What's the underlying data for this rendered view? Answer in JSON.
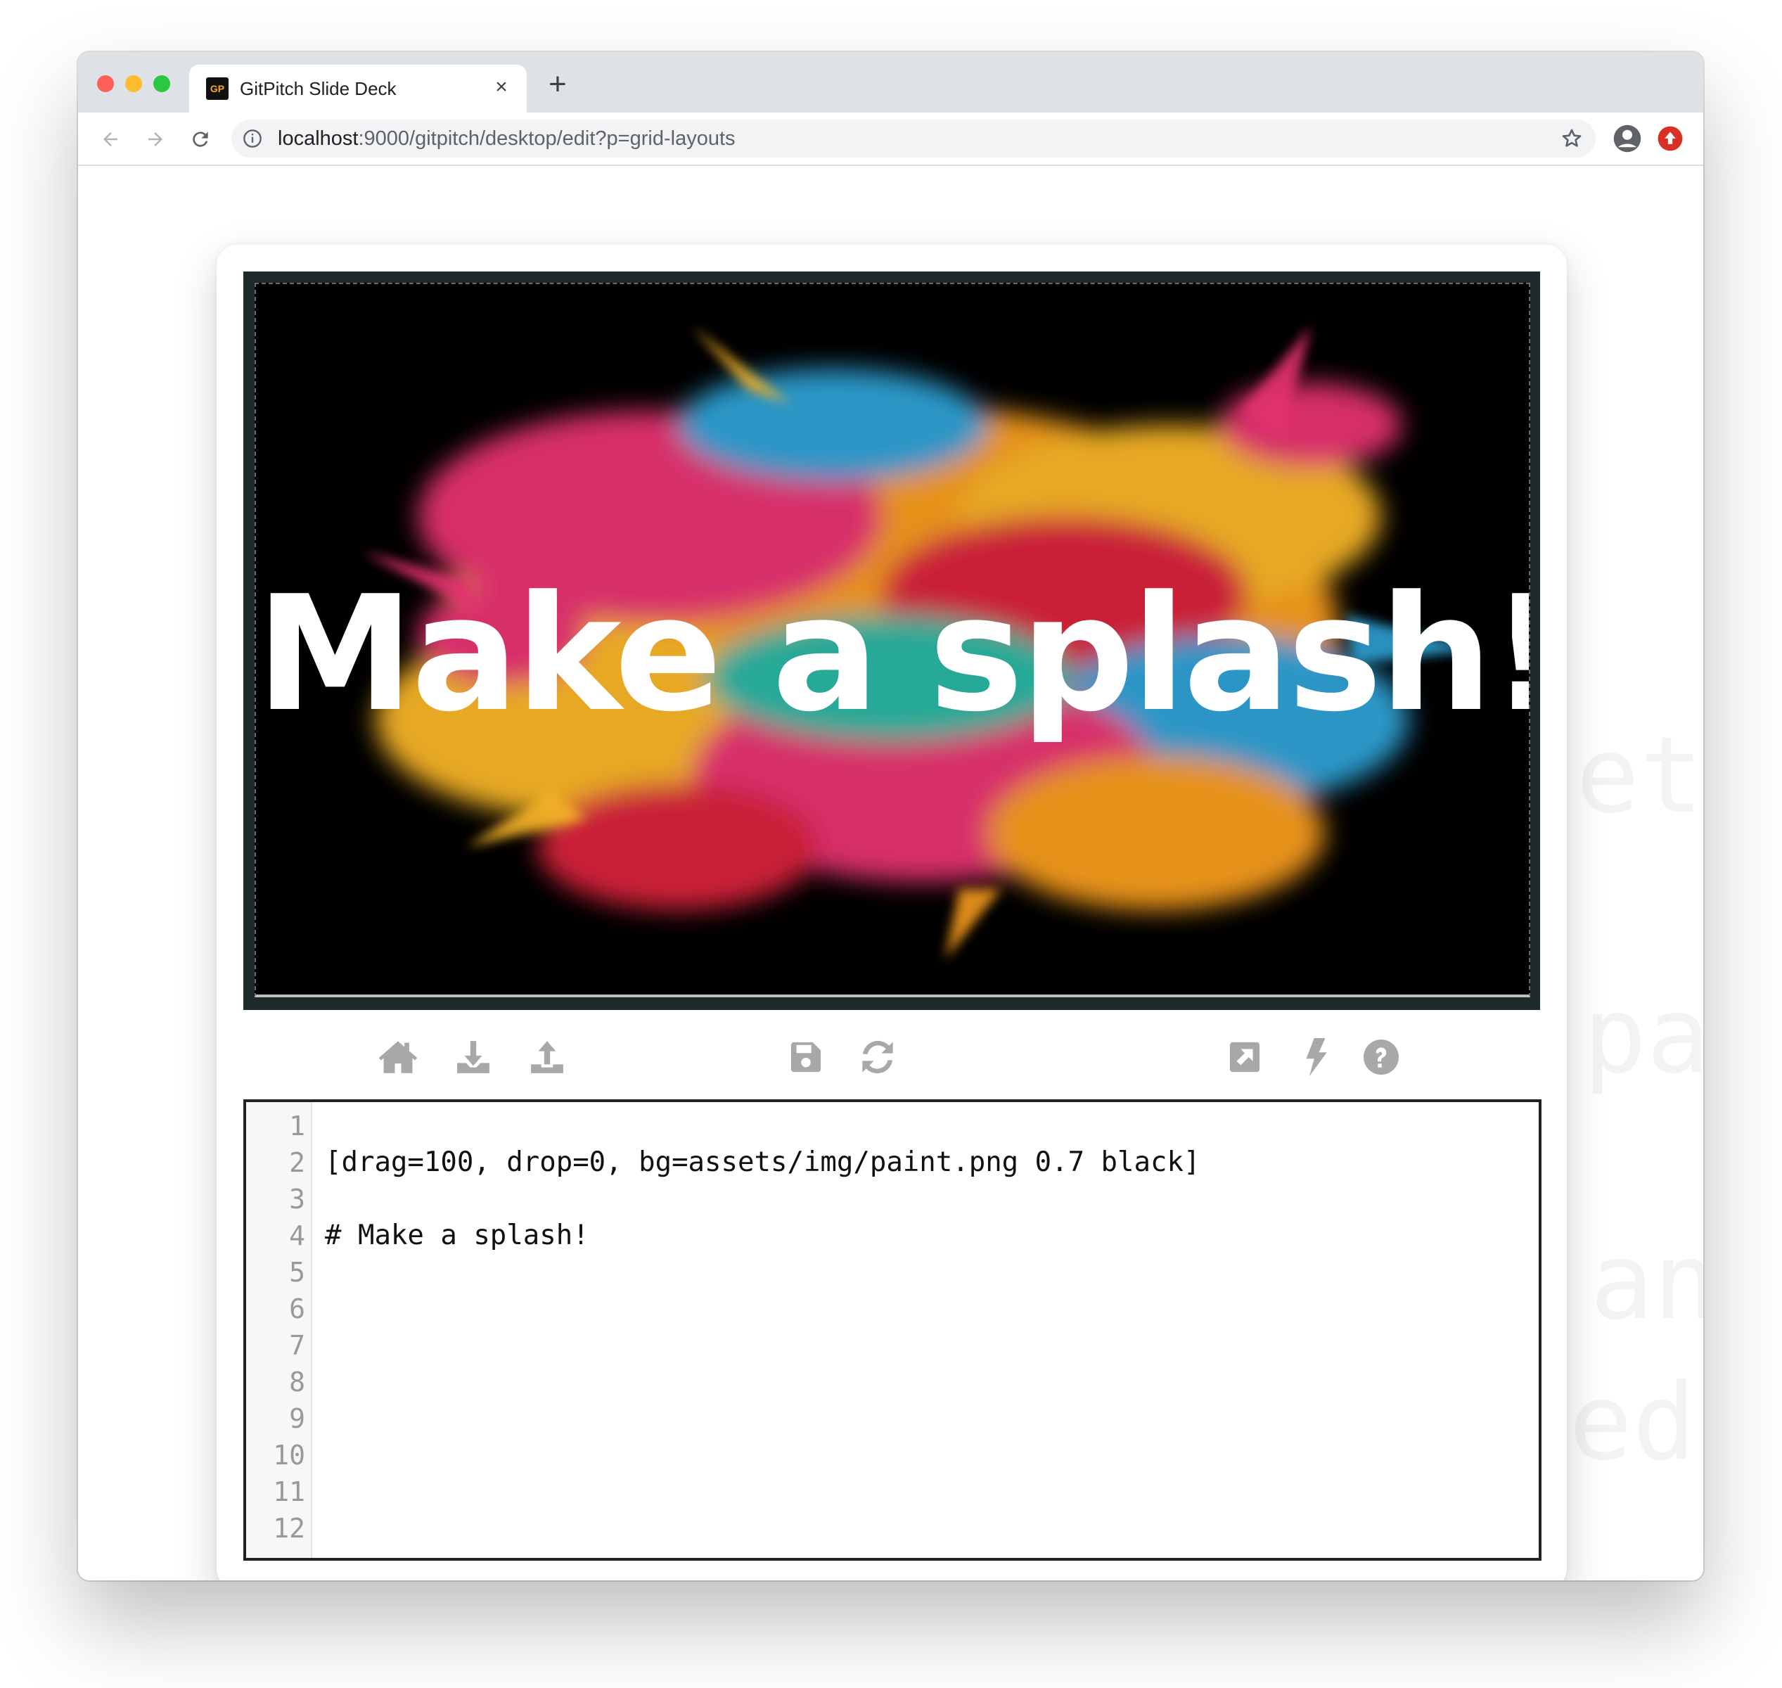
{
  "browser": {
    "tab": {
      "favicon_text": "GP",
      "title": "GitPitch Slide Deck"
    },
    "close_glyph": "×",
    "new_tab_glyph": "+",
    "url_host": "localhost",
    "url_path": ":9000/gitpitch/desktop/edit?p=grid-layouts"
  },
  "slide": {
    "heading": "Make a splash!",
    "background": "paint splash on black",
    "colors": {
      "pink": "#e3306f",
      "yellow": "#f4b228",
      "orange": "#f39a1e",
      "red": "#d4243b",
      "blue": "#2f9fd1",
      "teal": "#2bb3a0"
    }
  },
  "toolbar_icons": [
    "home-icon",
    "download-icon",
    "upload-icon",
    "save-icon",
    "refresh-icon",
    "external-link-icon",
    "lightning-icon",
    "help-icon"
  ],
  "editor": {
    "line_numbers": [
      "1",
      "2",
      "3",
      "4",
      "5",
      "6",
      "7",
      "8",
      "9",
      "10",
      "11",
      "12"
    ],
    "lines": [
      "",
      "[drag=100, drop=0, bg=assets/img/paint.png 0.7 black]",
      "",
      "# Make a splash!",
      "",
      "",
      "",
      "",
      "",
      "",
      "",
      ""
    ]
  },
  "background_watermark": [
    "et",
    "pa",
    "an",
    "ed ("
  ]
}
